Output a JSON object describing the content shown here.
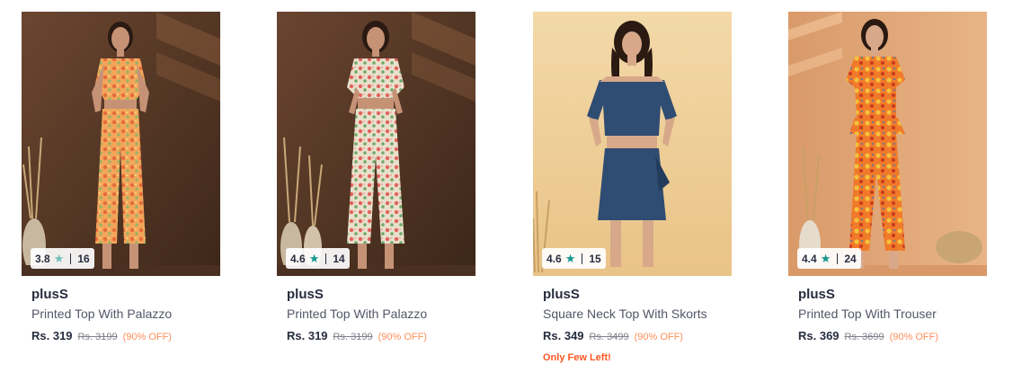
{
  "colors": {
    "star_grey": "#72bfbc",
    "star_teal": "#14958f",
    "discount": "#ff905a",
    "urgency": "#ff5722"
  },
  "products": [
    {
      "brand": "plusS",
      "name": "Printed Top With Palazzo",
      "price": "Rs. 319",
      "mrp": "Rs. 3199",
      "discount": "(90% OFF)",
      "rating": "3.8",
      "rating_count": "16",
      "star_icon": "star-icon",
      "urgency": ""
    },
    {
      "brand": "plusS",
      "name": "Printed Top With Palazzo",
      "price": "Rs. 319",
      "mrp": "Rs. 3199",
      "discount": "(90% OFF)",
      "rating": "4.6",
      "rating_count": "14",
      "star_icon": "star-icon",
      "urgency": ""
    },
    {
      "brand": "plusS",
      "name": "Square Neck Top With Skorts",
      "price": "Rs. 349",
      "mrp": "Rs. 3499",
      "discount": "(90% OFF)",
      "rating": "4.6",
      "rating_count": "15",
      "star_icon": "star-icon",
      "urgency": "Only Few Left!"
    },
    {
      "brand": "plusS",
      "name": "Printed Top With Trouser",
      "price": "Rs. 369",
      "mrp": "Rs. 3699",
      "discount": "(90% OFF)",
      "rating": "4.4",
      "rating_count": "24",
      "star_icon": "star-icon",
      "urgency": ""
    }
  ]
}
